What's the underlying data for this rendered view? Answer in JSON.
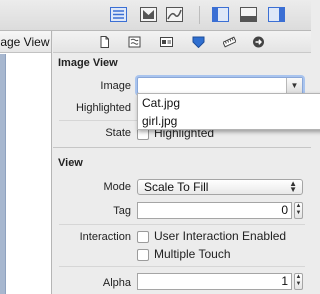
{
  "toolbar": {
    "icons": [
      "navigator-toggle-icon",
      "assistant-editor-icon",
      "version-editor-icon",
      "left-panel-toggle-icon",
      "bottom-panel-toggle-icon",
      "right-panel-toggle-icon"
    ],
    "accent": "#3b6fd4"
  },
  "left_panel": {
    "header": "Image View"
  },
  "inspector": {
    "tabs": [
      "file-inspector-icon",
      "quick-help-icon",
      "identity-inspector-icon",
      "attributes-inspector-icon",
      "size-inspector-icon",
      "connections-inspector-icon"
    ],
    "image_view": {
      "title": "Image View",
      "image_label": "Image",
      "image_value": "",
      "highlighted_label": "Highlighted",
      "state_label": "State",
      "state_checkbox_label": "Highlighted",
      "dropdown_options": [
        "Cat.jpg",
        "girl.jpg"
      ]
    },
    "view": {
      "title": "View",
      "mode_label": "Mode",
      "mode_value": "Scale To Fill",
      "tag_label": "Tag",
      "tag_value": "0",
      "interaction_label": "Interaction",
      "user_interaction": "User Interaction Enabled",
      "multiple_touch": "Multiple Touch",
      "alpha_label": "Alpha",
      "alpha_value": "1"
    }
  }
}
